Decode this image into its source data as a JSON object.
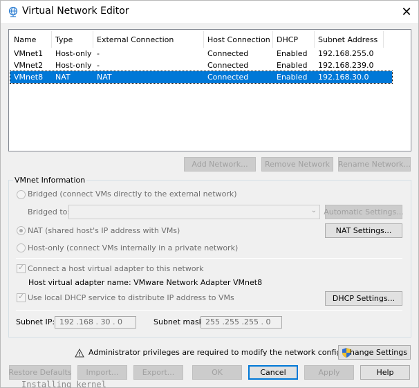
{
  "window": {
    "title": "Virtual Network Editor",
    "close_glyph": "✕"
  },
  "table": {
    "columns": [
      "Name",
      "Type",
      "External Connection",
      "Host Connection",
      "DHCP",
      "Subnet Address"
    ],
    "rows": [
      {
        "name": "VMnet1",
        "type": "Host-only",
        "external": "-",
        "host": "Connected",
        "dhcp": "Enabled",
        "subnet": "192.168.255.0",
        "selected": false
      },
      {
        "name": "VMnet2",
        "type": "Host-only",
        "external": "-",
        "host": "Connected",
        "dhcp": "Enabled",
        "subnet": "192.168.239.0",
        "selected": false
      },
      {
        "name": "VMnet8",
        "type": "NAT",
        "external": "NAT",
        "host": "Connected",
        "dhcp": "Enabled",
        "subnet": "192.168.30.0",
        "selected": true
      }
    ]
  },
  "network_buttons": {
    "add": "Add Network...",
    "remove": "Remove Network",
    "rename": "Rename Network..."
  },
  "vmnet_info": {
    "group_title": "VMnet Information",
    "bridged_label": "Bridged (connect VMs directly to the external network)",
    "bridged_to_label": "Bridged to:",
    "bridged_to_value": "",
    "automatic_settings": "Automatic Settings...",
    "nat_label": "NAT (shared host's IP address with VMs)",
    "nat_settings": "NAT Settings...",
    "hostonly_label": "Host-only (connect VMs internally in a private network)",
    "connect_adapter_label": "Connect a host virtual adapter to this network",
    "adapter_name_label": "Host virtual adapter name: VMware Network Adapter VMnet8",
    "dhcp_label": "Use local DHCP service to distribute IP address to VMs",
    "dhcp_settings": "DHCP Settings...",
    "subnet_ip_label": "Subnet IP:",
    "subnet_ip_value": "192 .168 . 30 . 0",
    "subnet_mask_label": "Subnet mask:",
    "subnet_mask_value": "255 .255 .255 . 0",
    "selected_mode": "nat",
    "connect_adapter_checked": true,
    "dhcp_checked": true
  },
  "admin": {
    "message": "Administrator privileges are required to modify the network configuration.",
    "change_settings": "Change Settings"
  },
  "footer_buttons": {
    "restore": "Restore Defaults",
    "import": "Import...",
    "export": "Export...",
    "ok": "OK",
    "cancel": "Cancel",
    "apply": "Apply",
    "help": "Help"
  },
  "background_text": "Installing kernel",
  "colors": {
    "selection": "#0078d7",
    "disabled_text": "#a0a0a0",
    "shield_blue": "#2f6fd1",
    "shield_yellow": "#f2c12e"
  },
  "icons": {
    "title": "network-globe-icon",
    "close": "close-icon",
    "warning": "warning-icon",
    "shield": "uac-shield-icon",
    "combo": "chevron-down-icon"
  }
}
